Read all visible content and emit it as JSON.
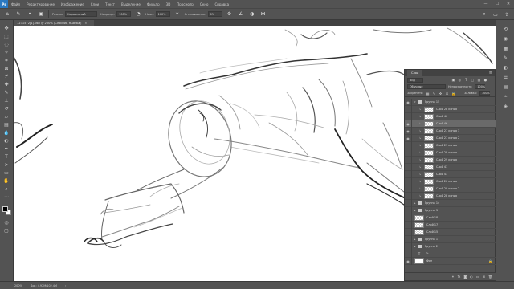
{
  "menubar": {
    "logo": "Ps",
    "items": [
      "Файл",
      "Редактирование",
      "Изображение",
      "Слои",
      "Текст",
      "Выделение",
      "Фильтр",
      "3D",
      "Просмотр",
      "Окно",
      "Справка"
    ],
    "controls": [
      "—",
      "☐",
      "✕"
    ]
  },
  "options": {
    "mode_label": "Режим:",
    "mode_value": "Нормальный",
    "opacity_label": "Непрозр.:",
    "opacity_value": "100%",
    "flow_label": "Наж.:",
    "flow_value": "100%",
    "smoothing_label": "Сглаживание:",
    "smoothing_value": "0%"
  },
  "document": {
    "tab_title": "1231572[1].psd @ 200% (Слой 46, RGB/8#)",
    "close": "✕"
  },
  "status": {
    "zoom": "200%",
    "doc_info": "Док: 4,92М/102,4М"
  },
  "layers_panel": {
    "tab_label": "Слои",
    "filter_label": "Вид",
    "blend_mode": "Обычные",
    "opacity_label": "Непрозрачность:",
    "opacity_value": "100%",
    "lock_label": "Закрепить:",
    "fill_label": "Заливка:",
    "fill_value": "100%",
    "layers": [
      {
        "name": "Группа 15",
        "type": "group",
        "visible": true,
        "indent": 0
      },
      {
        "name": "Слой 28 копия",
        "type": "layer",
        "visible": false,
        "indent": 1
      },
      {
        "name": "Слой 46",
        "type": "layer",
        "visible": false,
        "indent": 1
      },
      {
        "name": "Слой 46",
        "type": "layer",
        "visible": true,
        "indent": 1,
        "selected": true
      },
      {
        "name": "Слой 27 копия 3",
        "type": "layer",
        "visible": true,
        "indent": 1
      },
      {
        "name": "Слой 27 копия 2",
        "type": "layer",
        "visible": true,
        "indent": 1
      },
      {
        "name": "Слой 27 копия",
        "type": "layer",
        "visible": false,
        "indent": 1
      },
      {
        "name": "Слой 28 копия",
        "type": "layer",
        "visible": false,
        "indent": 1
      },
      {
        "name": "Слой 29 копия",
        "type": "layer",
        "visible": false,
        "indent": 1
      },
      {
        "name": "Слой 41",
        "type": "layer",
        "visible": false,
        "indent": 1
      },
      {
        "name": "Слой 43",
        "type": "layer",
        "visible": false,
        "indent": 1
      },
      {
        "name": "Слой 26 копия",
        "type": "layer",
        "visible": false,
        "indent": 1
      },
      {
        "name": "Слой 29 копия 2",
        "type": "layer",
        "visible": false,
        "indent": 1
      },
      {
        "name": "Слой 28 копия",
        "type": "layer",
        "visible": false,
        "indent": 1
      },
      {
        "name": "Группа 14",
        "type": "group",
        "visible": false,
        "indent": 0
      },
      {
        "name": "Группа 3",
        "type": "group",
        "visible": false,
        "indent": 0
      },
      {
        "name": "Слой 18",
        "type": "layer",
        "visible": false,
        "indent": 0
      },
      {
        "name": "Слой 17",
        "type": "layer",
        "visible": false,
        "indent": 0
      },
      {
        "name": "Слой 15",
        "type": "layer",
        "visible": false,
        "indent": 0
      },
      {
        "name": "Группа 1",
        "type": "group",
        "visible": false,
        "indent": 0
      },
      {
        "name": "Группа 2",
        "type": "group",
        "visible": false,
        "indent": 0
      },
      {
        "name": "Ъ",
        "type": "text",
        "visible": false,
        "indent": 0
      },
      {
        "name": "Фон",
        "type": "background",
        "visible": true,
        "indent": 0
      }
    ]
  }
}
